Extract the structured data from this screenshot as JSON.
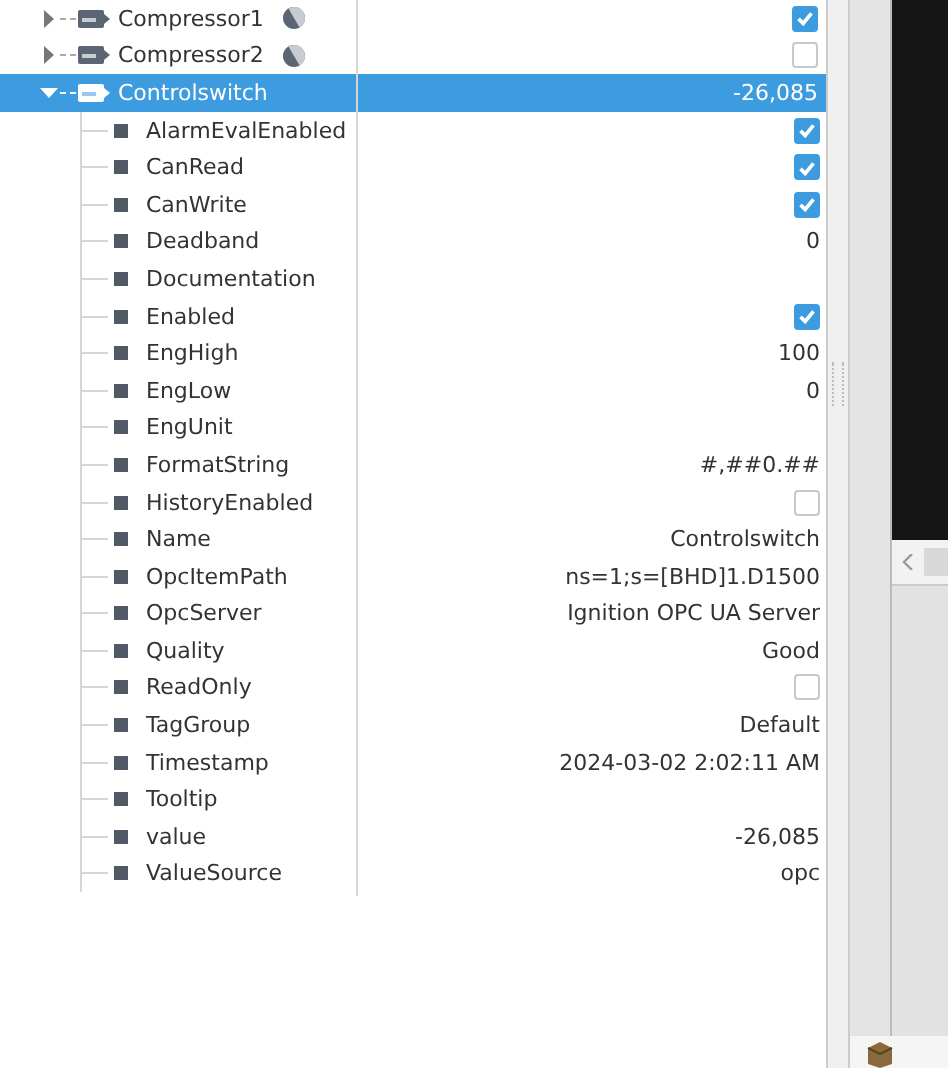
{
  "tree": [
    {
      "name": "Compressor1",
      "badge": true,
      "expanded": false,
      "selected": false,
      "value": {
        "kind": "check",
        "checked": true
      }
    },
    {
      "name": "Compressor2",
      "badge": true,
      "expanded": false,
      "selected": false,
      "value": {
        "kind": "check",
        "checked": false
      }
    },
    {
      "name": "Controlswitch",
      "badge": false,
      "expanded": true,
      "selected": true,
      "value": {
        "kind": "text",
        "text": "-26,085"
      },
      "children": [
        {
          "name": "AlarmEvalEnabled",
          "value": {
            "kind": "check",
            "checked": true
          }
        },
        {
          "name": "CanRead",
          "value": {
            "kind": "check",
            "checked": true
          }
        },
        {
          "name": "CanWrite",
          "value": {
            "kind": "check",
            "checked": true
          }
        },
        {
          "name": "Deadband",
          "value": {
            "kind": "text",
            "text": "0"
          }
        },
        {
          "name": "Documentation"
        },
        {
          "name": "Enabled",
          "value": {
            "kind": "check",
            "checked": true
          }
        },
        {
          "name": "EngHigh",
          "value": {
            "kind": "text",
            "text": "100"
          }
        },
        {
          "name": "EngLow",
          "value": {
            "kind": "text",
            "text": "0"
          }
        },
        {
          "name": "EngUnit"
        },
        {
          "name": "FormatString",
          "value": {
            "kind": "text",
            "text": "#,##0.##"
          }
        },
        {
          "name": "HistoryEnabled",
          "value": {
            "kind": "check",
            "checked": false
          }
        },
        {
          "name": "Name",
          "value": {
            "kind": "text",
            "text": "Controlswitch"
          }
        },
        {
          "name": "OpcItemPath",
          "value": {
            "kind": "text",
            "text": "ns=1;s=[BHD]1.D1500"
          }
        },
        {
          "name": "OpcServer",
          "value": {
            "kind": "text",
            "text": "Ignition OPC UA Server"
          }
        },
        {
          "name": "Quality",
          "value": {
            "kind": "text",
            "text": "Good"
          }
        },
        {
          "name": "ReadOnly",
          "value": {
            "kind": "check",
            "checked": false
          }
        },
        {
          "name": "TagGroup",
          "value": {
            "kind": "text",
            "text": "Default"
          }
        },
        {
          "name": "Timestamp",
          "value": {
            "kind": "text",
            "text": "2024-03-02 2:02:11 AM"
          }
        },
        {
          "name": "Tooltip"
        },
        {
          "name": "value",
          "value": {
            "kind": "text",
            "text": "-26,085"
          }
        },
        {
          "name": "ValueSource",
          "value": {
            "kind": "text",
            "text": "opc"
          }
        }
      ]
    }
  ]
}
